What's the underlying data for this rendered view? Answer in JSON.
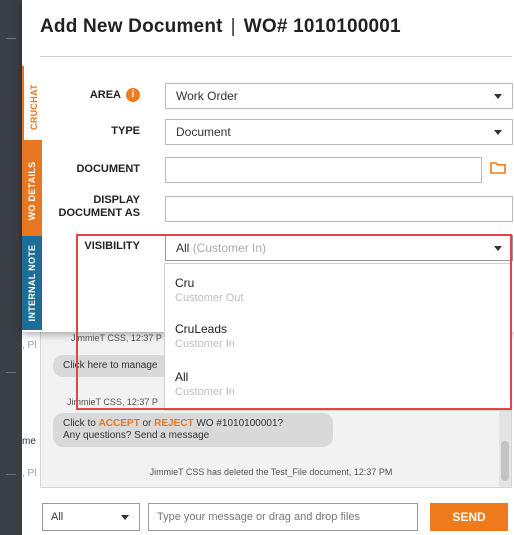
{
  "modal": {
    "title": "Add New Document",
    "separator": "|",
    "wo_number": "WO# 1010100001"
  },
  "side_tabs": {
    "cruchat": "CRUCHAT",
    "wo_details": "WO DETAILS",
    "internal_note": "INTERNAL NOTE"
  },
  "form": {
    "area_label": "AREA",
    "area_info_icon": "i",
    "area_value": "Work Order",
    "type_label": "TYPE",
    "type_value": "Document",
    "document_label": "DOCUMENT",
    "document_value": "",
    "display_label_line1": "DISPLAY",
    "display_label_line2": "DOCUMENT AS",
    "display_value": "",
    "visibility_label": "VISIBILITY",
    "visibility_value": "All",
    "visibility_hint": "(Customer In)"
  },
  "visibility_options": [
    {
      "label": "Cru",
      "sub": "Customer Out"
    },
    {
      "label": "CruLeads",
      "sub": "Customer In"
    },
    {
      "label": "All",
      "sub": "Customer In"
    }
  ],
  "chat": {
    "meta1": "JimmieT CSS, 12:37 P",
    "bubble1": "Click here to manage",
    "meta2": "JimmieT CSS, 12:37 P",
    "bubble2_prefix": "Click to ",
    "accept": "ACCEPT",
    "or": " or ",
    "reject": "REJECT",
    "bubble2_suffix": " WO #1010100001?",
    "bubble2_line2": "Any questions? Send a message",
    "system_message": "JimmieT CSS has deleted the Test_File document, 12:37 PM",
    "side_text1": ", Pl",
    "side_text2": "me",
    "side_text3": ", Pl"
  },
  "bottom": {
    "filter_value": "All",
    "message_placeholder": "Type your message or drag and drop files",
    "send_label": "SEND"
  },
  "colors": {
    "accent_orange": "#ef7b1d",
    "tab_blue": "#1d6e97",
    "highlight_red": "#e04646"
  },
  "icons": {
    "info": "info-icon",
    "folder": "folder-icon",
    "caret": "chevron-down-icon"
  }
}
